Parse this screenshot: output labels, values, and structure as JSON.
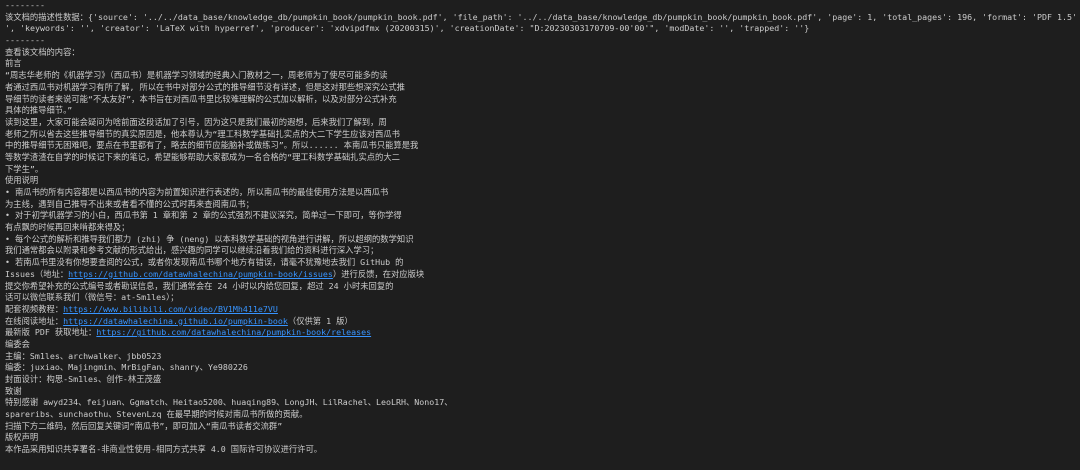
{
  "theme": {
    "background": "#1e1e1e",
    "text": "#cccccc",
    "link": "#3794ff"
  },
  "output": {
    "lines": [
      [
        {
          "t": "--------"
        }
      ],
      [
        {
          "t": "该文档的描述性数据：{'source': '../../data_base/knowledge_db/pumpkin_book/pumpkin_book.pdf', 'file_path': '../../data_base/knowledge_db/pumpkin_book/pumpkin_book.pdf', 'page': 1, 'total_pages': 196, 'format': 'PDF 1.5', 'title': '', 'author': '', 'subject': '"
        }
      ],
      [
        {
          "t": "', 'keywords': '', 'creator': 'LaTeX with hyperref', 'producer': 'xdvipdfmx (20200315)', 'creationDate': \"D:20230303170709-00'00'\", 'modDate': '', 'trapped': ''}"
        }
      ],
      [
        {
          "t": "--------"
        }
      ],
      [
        {
          "t": "查看该文档的内容："
        }
      ],
      [
        {
          "t": "前言"
        }
      ],
      [
        {
          "t": "“周志华老师的《机器学习》（西瓜书）是机器学习领域的经典入门教材之一，周老师为了使尽可能多的读"
        }
      ],
      [
        {
          "t": "者通过西瓜书对机器学习有所了解, 所以在书中对部分公式的推导细节没有详述，但是这对那些想深究公式推"
        }
      ],
      [
        {
          "t": "导细节的读者来说可能“不太友好”，本书旨在对西瓜书里比较难理解的公式加以解析，以及对部分公式补充"
        }
      ],
      [
        {
          "t": "具体的推导细节。”"
        }
      ],
      [
        {
          "t": "读到这里，大家可能会疑问为啥前面这段话加了引号，因为这只是我们最初的遐想，后来我们了解到，周"
        }
      ],
      [
        {
          "t": "老师之所以省去这些推导细节的真实原因是，他本尊认为“理工科数学基础扎实点的大二下学生应该对西瓜书"
        }
      ],
      [
        {
          "t": "中的推导细节无困难吧，要点在书里都有了，略去的细节应能脑补或做练习”。所以...... 本南瓜书只能算是我"
        }
      ],
      [
        {
          "t": "等数学渣渣在自学的时候记下来的笔记，希望能够帮助大家都成为一名合格的“理工科数学基础扎实点的大二"
        }
      ],
      [
        {
          "t": "下学生”。"
        }
      ],
      [
        {
          "t": "使用说明"
        }
      ],
      [
        {
          "t": "• 南瓜书的所有内容都是以西瓜书的内容为前置知识进行表述的，所以南瓜书的最佳使用方法是以西瓜书"
        }
      ],
      [
        {
          "t": "为主线，遇到自己推导不出来或者看不懂的公式时再来查阅南瓜书；"
        }
      ],
      [
        {
          "t": "• 对于初学机器学习的小白，西瓜书第 1 章和第 2 章的公式强烈不建议深究，简单过一下即可，等你学得"
        }
      ],
      [
        {
          "t": "有点飘的时候再回来啃都来得及；"
        }
      ],
      [
        {
          "t": "• 每个公式的解析和推导我们都力 (zhi) 争 (neng) 以本科数学基础的视角进行讲解，所以超纲的数学知识"
        }
      ],
      [
        {
          "t": "我们通常都会以附录和参考文献的形式给出，感兴趣的同学可以继续沿着我们给的资料进行深入学习；"
        }
      ],
      [
        {
          "t": "• 若南瓜书里没有你想要查阅的公式，或者你发现南瓜书哪个地方有错误，请毫不犹豫地去我们 GitHub 的"
        }
      ],
      [
        {
          "t": "Issues（地址："
        },
        {
          "t": "https://github.com/datawhalechina/pumpkin-book/issues",
          "link": true
        },
        {
          "t": "）进行反馈，在对应版块"
        }
      ],
      [
        {
          "t": "提交你希望补充的公式编号或者勘误信息，我们通常会在 24 小时以内给您回复，超过 24 小时未回复的"
        }
      ],
      [
        {
          "t": "话可以微信联系我们（微信号：at-Sm1les）；"
        }
      ],
      [
        {
          "t": "配套视频教程："
        },
        {
          "t": "https://www.bilibili.com/video/BV1Mh411e7VU",
          "link": true
        }
      ],
      [
        {
          "t": "在线阅读地址："
        },
        {
          "t": "https://datawhalechina.github.io/pumpkin-book",
          "link": true
        },
        {
          "t": "（仅供第 1 版）"
        }
      ],
      [
        {
          "t": "最新版 PDF 获取地址："
        },
        {
          "t": "https://github.com/datawhalechina/pumpkin-book/releases",
          "link": true
        }
      ],
      [
        {
          "t": "编委会"
        }
      ],
      [
        {
          "t": "主编：Sm1les、archwalker、jbb0523"
        }
      ],
      [
        {
          "t": "编委：juxiao、Majingmin、MrBigFan、shanry、Ye980226"
        }
      ],
      [
        {
          "t": "封面设计：构思-Sm1les、创作-林王茂盛"
        }
      ],
      [
        {
          "t": "致谢"
        }
      ],
      [
        {
          "t": "特别感谢 awyd234、feijuan、Ggmatch、Heitao5200、huaqing89、LongJH、LilRachel、LeoLRH、Nono17、"
        }
      ],
      [
        {
          "t": "spareribs、sunchaothu、StevenLzq 在最早期的时候对南瓜书所做的贡献。"
        }
      ],
      [
        {
          "t": "扫描下方二维码，然后回复关键词“南瓜书”，即可加入“南瓜书读者交流群”"
        }
      ],
      [
        {
          "t": "版权声明"
        }
      ],
      [
        {
          "t": "本作品采用知识共享署名-非商业性使用-相同方式共享 4.0 国际许可协议进行许可。"
        }
      ]
    ]
  }
}
